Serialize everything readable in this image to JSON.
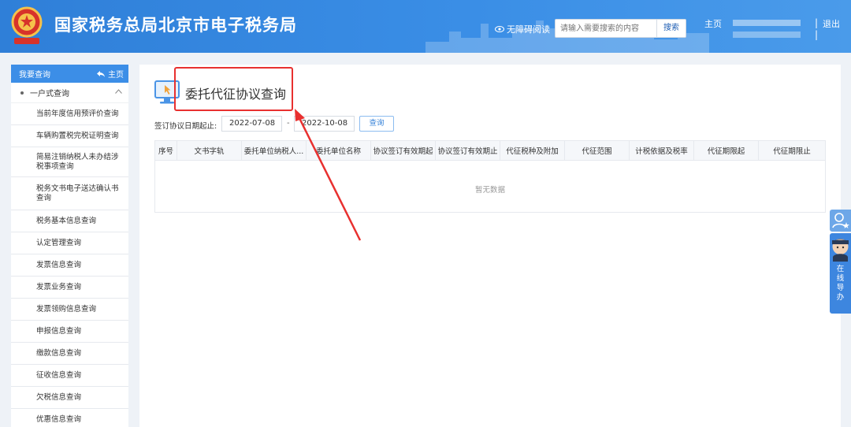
{
  "header": {
    "title": "国家税务总局北京市电子税务局",
    "emblem_text": "中国税务",
    "accessibility": "无障碍阅读",
    "search_placeholder": "请输入需要搜索的内容",
    "search_button": "搜索",
    "home": "主页",
    "separator": "|",
    "logout": "退出",
    "colors": {
      "bar": "#3a8ee6"
    }
  },
  "sidebar": {
    "header_title": "我要查询",
    "header_home": "主页",
    "group": "一户式查询",
    "items": [
      "当前年度信用预评价查询",
      "车辆购置税完税证明查询",
      "简易注销纳税人未办结涉税事项查询",
      "税务文书电子送达确认书查询",
      "税务基本信息查询",
      "认定管理查询",
      "发票信息查询",
      "发票业务查询",
      "发票领购信息查询",
      "申报信息查询",
      "缴款信息查询",
      "征收信息查询",
      "欠税信息查询",
      "优惠信息查询"
    ]
  },
  "main": {
    "title": "委托代征协议查询",
    "filter_label": "签订协议日期起止:",
    "date_start": "2022-07-08",
    "date_end": "2022-10-08",
    "date_separator": "-",
    "query_button": "查询",
    "columns": [
      "序号",
      "文书字轨",
      "委托单位纳税人...",
      "委托单位名称",
      "协议签订有效期起",
      "协议签订有效期止",
      "代征税种及附加",
      "代征范围",
      "计税依据及税率",
      "代征期限起",
      "代征期限止"
    ],
    "empty_text": "暂无数据",
    "highlight_color": "#e8302f"
  },
  "float": {
    "guide_label": "在线导办"
  }
}
